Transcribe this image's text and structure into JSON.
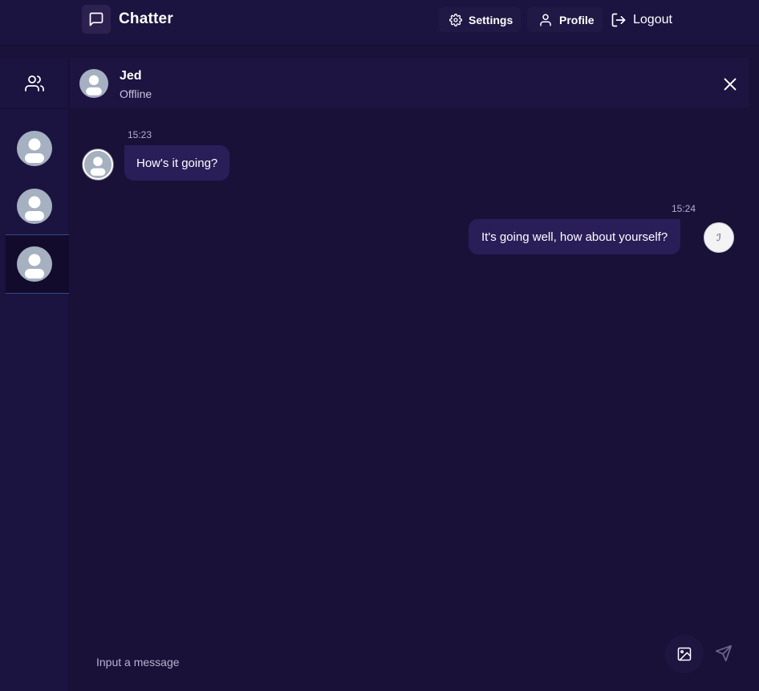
{
  "app": {
    "title": "Chatter",
    "logo_icon": "message-square-icon"
  },
  "nav": {
    "settings_label": "Settings",
    "profile_label": "Profile",
    "logout_label": "Logout"
  },
  "sidebar": {
    "header_icon": "users-icon",
    "contacts": [
      {
        "avatar": "default-avatar",
        "selected": false
      },
      {
        "avatar": "default-avatar",
        "selected": false
      },
      {
        "avatar": "default-avatar",
        "selected": true
      }
    ]
  },
  "chat": {
    "contact_name": "Jed",
    "contact_status": "Offline",
    "messages": [
      {
        "direction": "incoming",
        "time": "15:23",
        "text": "How's it going?"
      },
      {
        "direction": "outgoing",
        "time": "15:24",
        "text": "It's going well, how about yourself?",
        "avatar_glyph": "ℐ"
      }
    ]
  },
  "composer": {
    "placeholder": "Input a message",
    "value": ""
  },
  "colors": {
    "background": "#1a1139",
    "bubble": "#2a1e59",
    "avatar": "#a5b0c1",
    "selected_border": "#2f4b8a"
  }
}
